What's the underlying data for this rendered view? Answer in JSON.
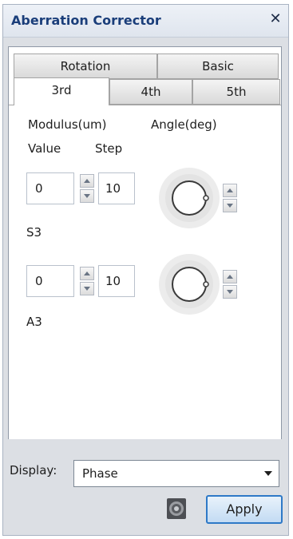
{
  "window": {
    "title": "Aberration Corrector",
    "close_glyph": "✕"
  },
  "tabs": {
    "row1": [
      "Rotation",
      "Basic"
    ],
    "row2": [
      "3rd",
      "4th",
      "5th"
    ],
    "active": "3rd"
  },
  "headers": {
    "modulus": "Modulus(um)",
    "angle": "Angle(deg)",
    "value": "Value",
    "step": "Step"
  },
  "rows": [
    {
      "value": "0",
      "step": "10",
      "label": "S3"
    },
    {
      "value": "0",
      "step": "10",
      "label": "A3"
    }
  ],
  "display": {
    "label": "Display:",
    "selected": "Phase"
  },
  "buttons": {
    "apply": "Apply"
  },
  "icons": {
    "close": "close-icon",
    "spin_up": "arrow-up-icon",
    "spin_down": "arrow-down-icon",
    "dial": "angle-dial-icon",
    "snapshot": "target-icon",
    "dropdown": "chevron-down-icon"
  },
  "colors": {
    "title_text": "#1a3e7a",
    "window_bg": "#dcdfe4",
    "apply_border": "#2e79c7"
  }
}
